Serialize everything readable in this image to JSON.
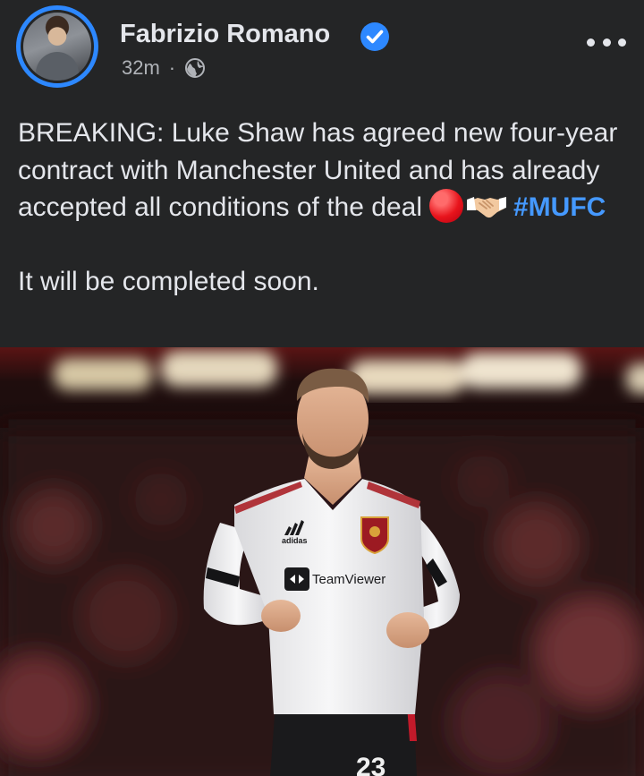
{
  "post": {
    "author": "Fabrizio Romano",
    "timestamp": "32m",
    "separator": "·",
    "privacy_icon": "globe-icon",
    "verified_icon": "verified-badge-icon",
    "more_icon": "more-options-icon",
    "text_line_1": "BREAKING: Luke Shaw has agreed new four-year contract with Manchester United and has already accepted all conditions of the deal",
    "hashtag": "#MUFC",
    "text_line_2": "It will be completed soon.",
    "emojis": [
      "red-circle-icon",
      "handshake-icon"
    ]
  },
  "photo": {
    "sponsor": "TeamViewer",
    "kit_brand": "adidas",
    "shirt_number": "23"
  },
  "colors": {
    "background": "#242526",
    "text": "#e4e6eb",
    "secondary_text": "#b0b3b8",
    "accent": "#2d88ff",
    "hashtag": "#4599ff"
  }
}
